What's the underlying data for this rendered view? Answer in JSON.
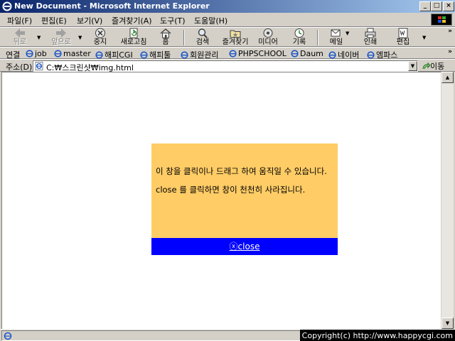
{
  "window": {
    "title": "New Document - Microsoft Internet Explorer"
  },
  "menu": [
    "파일(F)",
    "편집(E)",
    "보기(V)",
    "즐겨찾기(A)",
    "도구(T)",
    "도움말(H)"
  ],
  "toolbar": {
    "back": "뒤로",
    "forward": "앞으로",
    "stop": "중지",
    "refresh": "새로고침",
    "home": "홈",
    "search": "검색",
    "favorites": "즐겨찾기",
    "media": "미디어",
    "history": "기록",
    "mail": "메일",
    "print": "인쇄",
    "edit": "편집"
  },
  "links": {
    "label": "연결",
    "items": [
      "job",
      "master",
      "해피CGI",
      "해피툴",
      "회원관리",
      "PHPSCHOOL",
      "Daum",
      "네이버",
      "엠파스"
    ]
  },
  "address": {
    "label": "주소(D)",
    "value": "C:₩스크린샷₩img.html",
    "go": "이동"
  },
  "popup": {
    "line1": "이 창을 클릭이나 드래그 하여 움직일 수 있습니다.",
    "line2": "close 를 클릭하면 창이 천천히 사라집니다.",
    "close_symbol": "ⓧ",
    "close_label": "close",
    "bg_color": "#ffcc66",
    "bar_color": "#0000ff"
  },
  "status": {
    "copyright": "Copyright(c) http://www.happycgi.com"
  }
}
